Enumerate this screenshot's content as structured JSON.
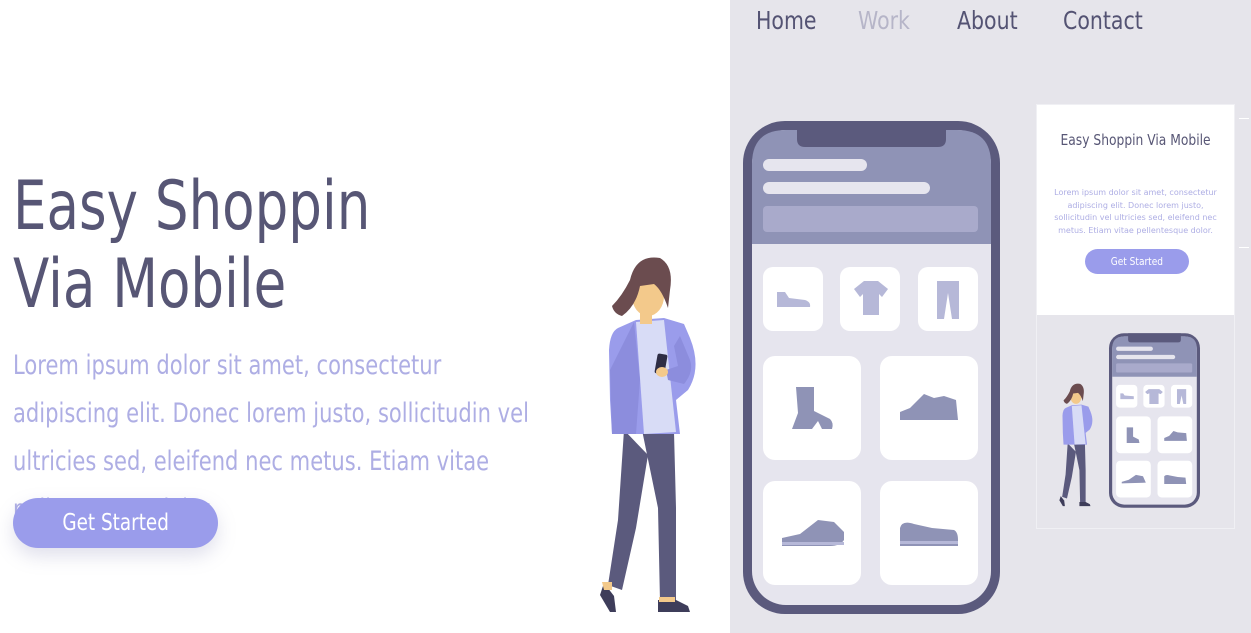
{
  "nav": {
    "items": [
      {
        "label": "Home",
        "active": false
      },
      {
        "label": "Work",
        "active": true
      },
      {
        "label": "About",
        "active": false
      },
      {
        "label": "Contact",
        "active": false
      }
    ]
  },
  "hero": {
    "title_line1": "Easy Shoppin",
    "title_line2": "Via Mobile",
    "description": "Lorem ipsum dolor sit amet, consectetur adipiscing elit. Donec lorem justo, sollicitudin vel ultricies sed, eleifend nec metus. Etiam vitae pellentesque dolor.",
    "cta_label": "Get Started"
  },
  "preview": {
    "title": "Easy Shoppin Via Mobile",
    "description": "Lorem ipsum dolor sit amet, consectetur adipiscing elit. Donec lorem justo, sollicitudin vel ultricies sed, eleifend nec metus. Etiam vitae pellentesque dolor.",
    "cta_label": "Get Started"
  },
  "illustration": {
    "product_icons": [
      "shoe-icon",
      "tshirt-icon",
      "pants-icon",
      "boot-icon",
      "sneaker-icon",
      "flat-shoe-icon",
      "slip-on-icon"
    ]
  },
  "colors": {
    "primary_text": "#575675",
    "accent": "#9a9ceb",
    "muted_text": "#aeaee4",
    "panel_bg": "#e6e5eb",
    "phone_frame": "#5b5a7d"
  }
}
